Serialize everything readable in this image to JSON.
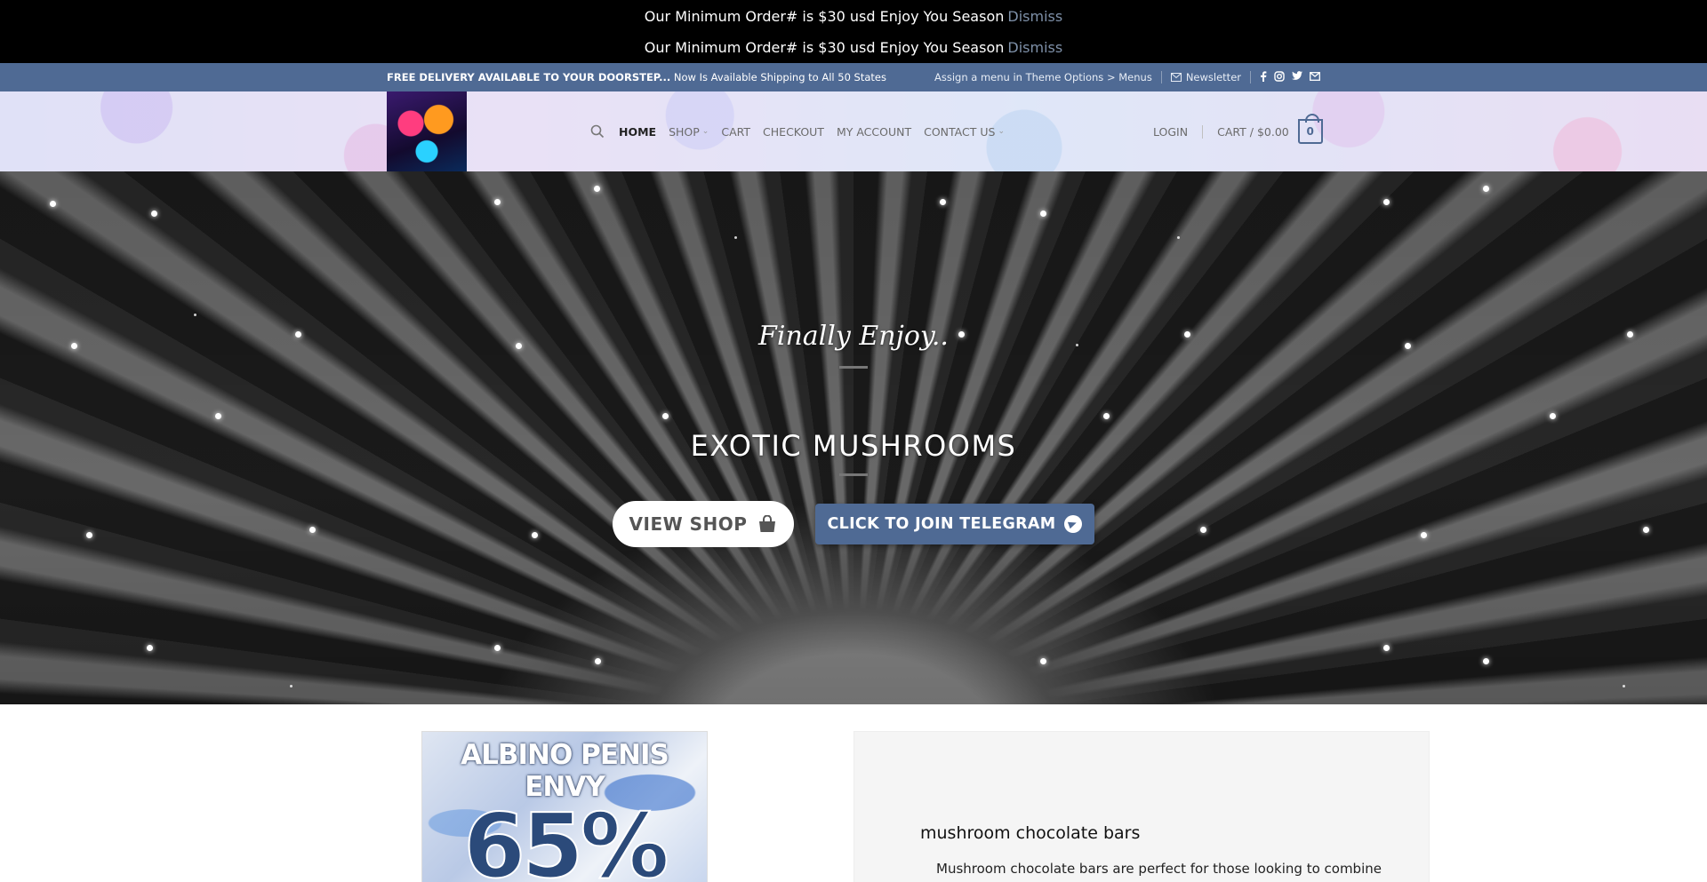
{
  "notices": [
    {
      "text": "Our Minimum Order# is $30 usd Enjoy You Season",
      "dismiss": "Dismiss"
    },
    {
      "text": "Our Minimum Order# is $30 usd Enjoy You Season",
      "dismiss": "Dismiss"
    }
  ],
  "topbar": {
    "left_bold": "FREE DELIVERY AVAILABLE TO YOUR DOORSTEP...",
    "left_text": "Now Is Available Shipping to All 50 States",
    "menu_hint": "Assign a menu in Theme Options > Menus",
    "newsletter": "Newsletter",
    "social": [
      "facebook-icon",
      "instagram-icon",
      "twitter-icon",
      "email-icon"
    ]
  },
  "nav": {
    "items": [
      {
        "label": "HOME",
        "active": true,
        "dropdown": false
      },
      {
        "label": "SHOP",
        "active": false,
        "dropdown": true
      },
      {
        "label": "CART",
        "active": false,
        "dropdown": false
      },
      {
        "label": "CHECKOUT",
        "active": false,
        "dropdown": false
      },
      {
        "label": "MY ACCOUNT",
        "active": false,
        "dropdown": false
      },
      {
        "label": "CONTACT US",
        "active": false,
        "dropdown": true
      }
    ],
    "login": "LOGIN",
    "cart_label": "CART / $0.00",
    "cart_count": "0"
  },
  "hero": {
    "tagline": "Finally Enjoy..",
    "headline": "EXOTIC MUSHROOMS",
    "shop_button": "VIEW SHOP",
    "telegram_button": "CLICK TO JOIN TELEGRAM"
  },
  "product": {
    "title": "ALBINO PENIS ENVY",
    "percent": "65%"
  },
  "info": {
    "title": "mushroom chocolate bars",
    "text": "Mushroom chocolate bars are perfect for those looking to combine"
  },
  "colors": {
    "accent": "#4f6a94",
    "notice_bg": "#000000",
    "dismiss": "#7e90a8"
  }
}
